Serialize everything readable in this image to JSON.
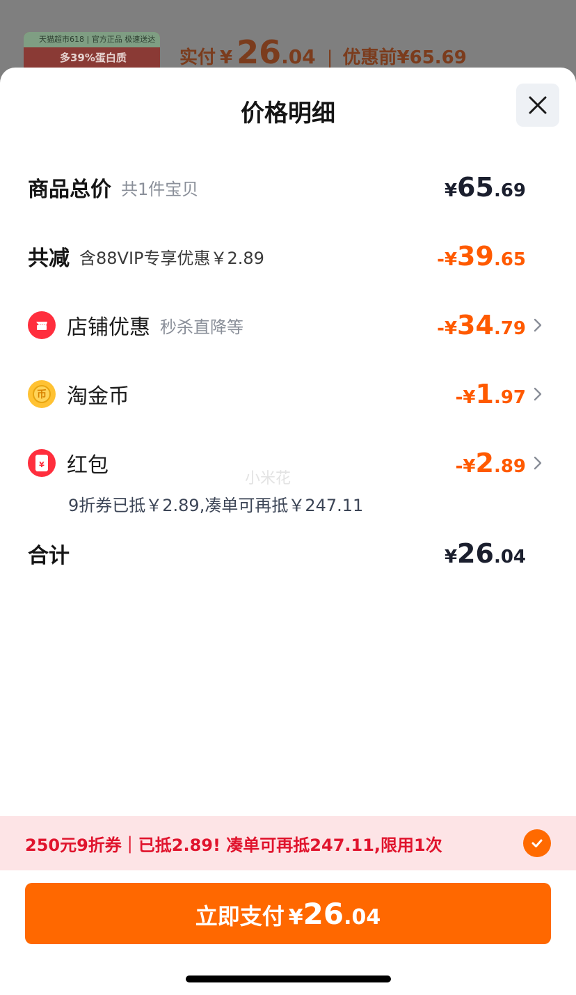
{
  "background": {
    "thumb_banner": "天猫超市618 | 官方正品 极速送达",
    "thumb_headline": "多39%蛋白质",
    "paid_label": "实付",
    "paid_currency": "¥",
    "paid_int": "26",
    "paid_dec": ".04",
    "separator": "|",
    "original_label": "优惠前",
    "original_price": "¥65.69"
  },
  "sheet": {
    "title": "价格明细",
    "close_icon": "close-icon"
  },
  "rows": {
    "subtotal": {
      "label": "商品总价",
      "sub": "共1件宝贝",
      "currency": "¥",
      "int": "65",
      "dec": ".69"
    },
    "reduction": {
      "label": "共减",
      "sub": "含88VIP专享优惠￥2.89",
      "currency": "-¥",
      "int": "39",
      "dec": ".65"
    },
    "shop": {
      "label": "店铺优惠",
      "sub": "秒杀直降等",
      "currency": "-¥",
      "int": "34",
      "dec": ".79",
      "icon": "shop-icon"
    },
    "coins": {
      "label": "淘金币",
      "currency": "-¥",
      "int": "1",
      "dec": ".97",
      "icon": "coin-icon"
    },
    "hongbao": {
      "label": "红包",
      "currency": "-¥",
      "int": "2",
      "dec": ".89",
      "icon": "red-envelope-icon",
      "note": "9折券已抵￥2.89,凑单可再抵￥247.11"
    },
    "total": {
      "label": "合计",
      "currency": "¥",
      "int": "26",
      "dec": ".04"
    }
  },
  "watermark": "小米花",
  "coupon": {
    "text": "250元9折券｜已抵2.89! 凑单可再抵247.11,限用1次",
    "checked": true
  },
  "pay_button": {
    "label": "立即支付",
    "currency": "¥",
    "int": "26",
    "dec": ".04"
  },
  "colors": {
    "accent": "#ff6800",
    "discount": "#ff5a00",
    "coupon_text": "#e0142d",
    "coupon_bg": "#fde4e6"
  }
}
